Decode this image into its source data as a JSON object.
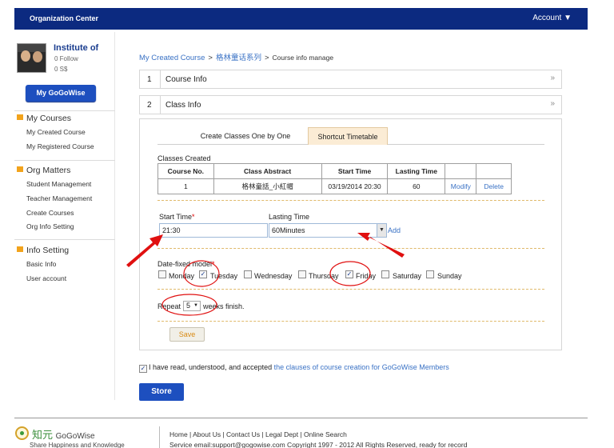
{
  "topbar": {
    "title": "Organization Center",
    "account": "Account ▼"
  },
  "profile": {
    "name": "Institute of",
    "follow": "0 Follow",
    "ss": "0 S$"
  },
  "sidebar": {
    "button": "My GoGoWise",
    "sections": [
      {
        "title": "My Courses",
        "items": [
          "My Created Course",
          "My Registered Course"
        ]
      },
      {
        "title": "Org Matters",
        "items": [
          "Student Management",
          "Teacher Management",
          "Create Courses",
          "Org Info Setting"
        ]
      },
      {
        "title": "Info Setting",
        "items": [
          "Basic Info",
          "User account"
        ]
      }
    ]
  },
  "breadcrumb": {
    "link1": "My Created Course",
    "link2": "格林童话系列",
    "current": "Course info manage",
    "sep": ">"
  },
  "accordion": [
    {
      "num": "1",
      "label": "Course Info"
    },
    {
      "num": "2",
      "label": "Class Info"
    }
  ],
  "tabs": [
    "Create Classes One by One",
    "Shortcut Timetable"
  ],
  "classes": {
    "label": "Classes Created",
    "headers": [
      "Course No.",
      "Class Abstract",
      "Start Time",
      "Lasting Time",
      "",
      ""
    ],
    "rows": [
      [
        "1",
        "格林童話_小紅帽",
        "03/19/2014 20:30",
        "60",
        "Modify",
        "Delete"
      ]
    ]
  },
  "form": {
    "start_label": "Start Time",
    "start_value": "21:30",
    "lasting_label": "Lasting Time",
    "lasting_value": "60Minutes",
    "add": "Add",
    "required_mark": "*",
    "date_label": "Date-fixed model",
    "days": [
      {
        "label": "Monday",
        "checked": false
      },
      {
        "label": "Tuesday",
        "checked": true
      },
      {
        "label": "Wednesday",
        "checked": false
      },
      {
        "label": "Thursday",
        "checked": false
      },
      {
        "label": "Friday",
        "checked": true
      },
      {
        "label": "Saturday",
        "checked": false
      },
      {
        "label": "Sunday",
        "checked": false
      }
    ],
    "repeat_prefix": "Repeat",
    "repeat_value": "5",
    "repeat_suffix": "weeks finish.",
    "save": "Save"
  },
  "agree": {
    "text": "I have read, understood, and accepted",
    "link": "the clauses of course creation for GoGoWise Members",
    "checked": true
  },
  "store": "Store",
  "footer": {
    "logo_cn": "知元",
    "logo_en": "GoGoWise",
    "slogan": "Share Happiness and Knowledge",
    "links": "Home | About Us | Contact Us | Legal Dept | Online Search",
    "copyright": "Service email:support@gogowise.com    Copyright 1997 - 2012 All Rights Reserved, ready for record"
  },
  "colors": {
    "topbar": "#0c2a80",
    "primary_button": "#1d4fbf",
    "link": "#3a72c5",
    "annotation": "#e01010",
    "section_mark": "#f2a31c"
  }
}
